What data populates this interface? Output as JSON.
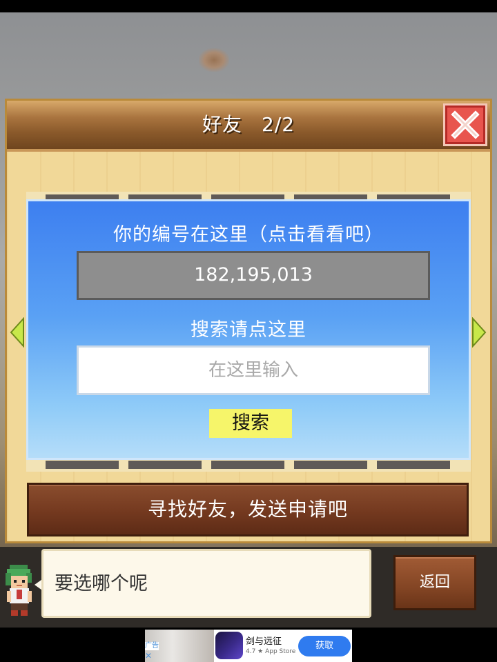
{
  "window": {
    "title": "好友",
    "page_indicator": "2/2"
  },
  "friend_panel": {
    "id_label": "你的编号在这里（点击看看吧）",
    "id_value": "182,195,013",
    "search_label": "搜索请点这里",
    "search_placeholder": "在这里输入",
    "search_value": "",
    "search_button": "搜索",
    "find_friends_button": "寻找好友，发送申请吧"
  },
  "dialog": {
    "message": "要选哪个呢",
    "back_button": "返回"
  },
  "ad": {
    "badge": "广告",
    "close": "✕",
    "app_name": "剑与远征",
    "rating": "4.7 ★ App Store",
    "get_button": "获取"
  },
  "colors": {
    "title_bar": "#8b5a2b",
    "panel_bg": "#f1d898",
    "blue_panel_top": "#3d7ff0",
    "close_button": "#e8554e",
    "search_button": "#f6f56a",
    "find_bar": "#74391f",
    "arrow": "#c8e84a"
  },
  "icons": {
    "close": "close-x-icon",
    "left_arrow": "triangle-left-icon",
    "right_arrow": "triangle-right-icon"
  }
}
